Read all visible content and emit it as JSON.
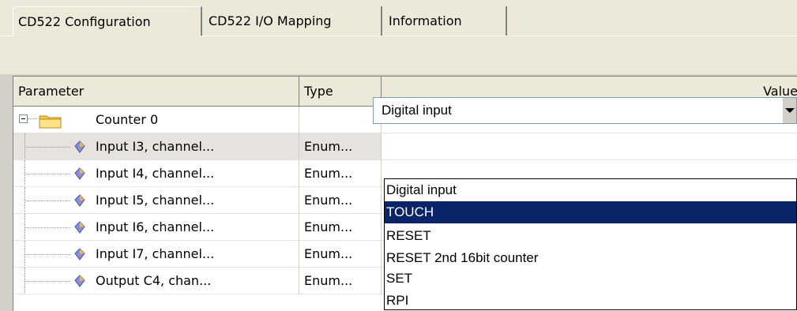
{
  "tabs": [
    {
      "label": "CD522 Configuration",
      "active": true
    },
    {
      "label": "CD522 I/O Mapping",
      "active": false
    },
    {
      "label": "Information",
      "active": false
    }
  ],
  "grid": {
    "headers": {
      "parameter": "Parameter",
      "type": "Type",
      "value": "Value"
    },
    "folder": {
      "label": "Counter 0",
      "icon": "folder-icon",
      "expanded": true
    },
    "rows": [
      {
        "parameter": "Input I3, channel...",
        "type": "Enum...",
        "selected": true,
        "icon": "parameter-icon"
      },
      {
        "parameter": "Input I4, channel...",
        "type": "Enum...",
        "icon": "parameter-icon"
      },
      {
        "parameter": "Input I5, channel...",
        "type": "Enum...",
        "icon": "parameter-icon"
      },
      {
        "parameter": "Input I6, channel...",
        "type": "Enum...",
        "icon": "parameter-icon"
      },
      {
        "parameter": "Input I7, channel...",
        "type": "Enum...",
        "icon": "parameter-icon"
      },
      {
        "parameter": "Output C4, chan...",
        "type": "Enum...",
        "icon": "parameter-icon"
      }
    ]
  },
  "combo": {
    "value": "Digital input",
    "button_icon": "dropdown-arrow-icon"
  },
  "dropdown": {
    "options": [
      "Digital input",
      "TOUCH",
      "RESET",
      "RESET 2nd 16bit counter",
      "SET",
      "RPI"
    ],
    "highlighted": "TOUCH"
  },
  "colors": {
    "selection": "#0a246a",
    "chrome": "#ece9d8",
    "folder": "#f2c94c"
  }
}
